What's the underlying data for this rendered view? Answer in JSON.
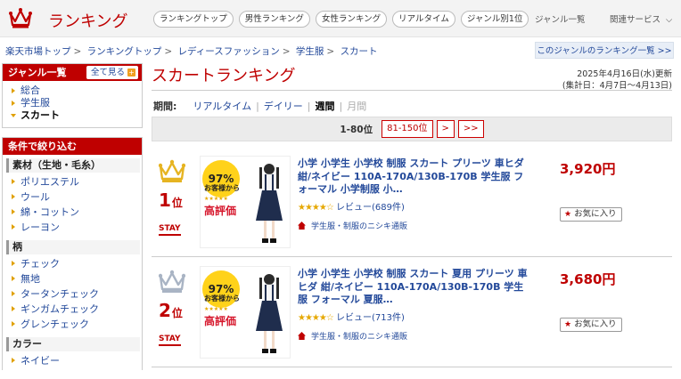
{
  "header": {
    "logo_text": "ランキング",
    "nav": [
      "ランキングトップ",
      "男性ランキング",
      "女性ランキング",
      "リアルタイム",
      "ジャンル別1位"
    ],
    "genre_list": "ジャンル一覧",
    "related": "関連サービス"
  },
  "breadcrumb": [
    "楽天市場トップ",
    "ランキングトップ",
    "レディースファッション",
    "学生服",
    "スカート"
  ],
  "genre_ranking_link": "このジャンルのランキング一覧 >>",
  "sidebar": {
    "genre_head": "ジャンル一覧",
    "see_all": "全て見る",
    "genres": [
      {
        "label": "総合",
        "current": false
      },
      {
        "label": "学生服",
        "current": false
      },
      {
        "label": "スカート",
        "current": true
      }
    ],
    "filter_head": "条件で絞り込む",
    "filters": [
      {
        "title": "素材（生地・毛糸）",
        "items": [
          "ポリエステル",
          "ウール",
          "綿・コットン",
          "レーヨン"
        ]
      },
      {
        "title": "柄",
        "items": [
          "チェック",
          "無地",
          "タータンチェック",
          "ギンガムチェック",
          "グレンチェック"
        ]
      },
      {
        "title": "カラー",
        "items": [
          "ネイビー"
        ]
      }
    ]
  },
  "main": {
    "title": "スカートランキング",
    "updated": "2025年4月16日(水)更新",
    "period_range": "(集計日：4月7日〜4月13日)",
    "period_label": "期間:",
    "periods": [
      {
        "label": "リアルタイム",
        "state": "link"
      },
      {
        "label": "デイリー",
        "state": "link"
      },
      {
        "label": "週間",
        "state": "current"
      },
      {
        "label": "月間",
        "state": "disabled"
      }
    ],
    "pager": {
      "current": "1-80位",
      "next_range": "81-150位",
      "next": ">",
      "last": ">>"
    }
  },
  "items": [
    {
      "rank": "1",
      "rank_suffix": "位",
      "crown_color": "#e6b422",
      "stay": "STAY",
      "name": "小学 小学生 小学校 制服 スカート プリーツ 車ヒダ 紺/ネイビー 110A-170A/130B-170B 学生服 フォーマル 小学制服 小…",
      "rating": 4.5,
      "stars": "★★★★☆",
      "review": "レビュー(689件)",
      "shop": "学生服・制服のニシキ通販",
      "price": "3,920円",
      "fav": "お気に入り",
      "thumb_badge": "97%",
      "thumb_line": "お客様から",
      "thumb_big": "高評価"
    },
    {
      "rank": "2",
      "rank_suffix": "位",
      "crown_color": "#a9b4c4",
      "stay": "STAY",
      "name": "小学 小学生 小学校 制服 スカート 夏用 プリーツ 車ヒダ 紺/ネイビー 110A-170A/130B-170B 学生服 フォーマル 夏服…",
      "rating": 4.5,
      "stars": "★★★★☆",
      "review": "レビュー(713件)",
      "shop": "学生服・制服のニシキ通販",
      "price": "3,680円",
      "fav": "お気に入り",
      "thumb_badge": "97%",
      "thumb_line": "お客様から",
      "thumb_big": "高評価"
    }
  ]
}
